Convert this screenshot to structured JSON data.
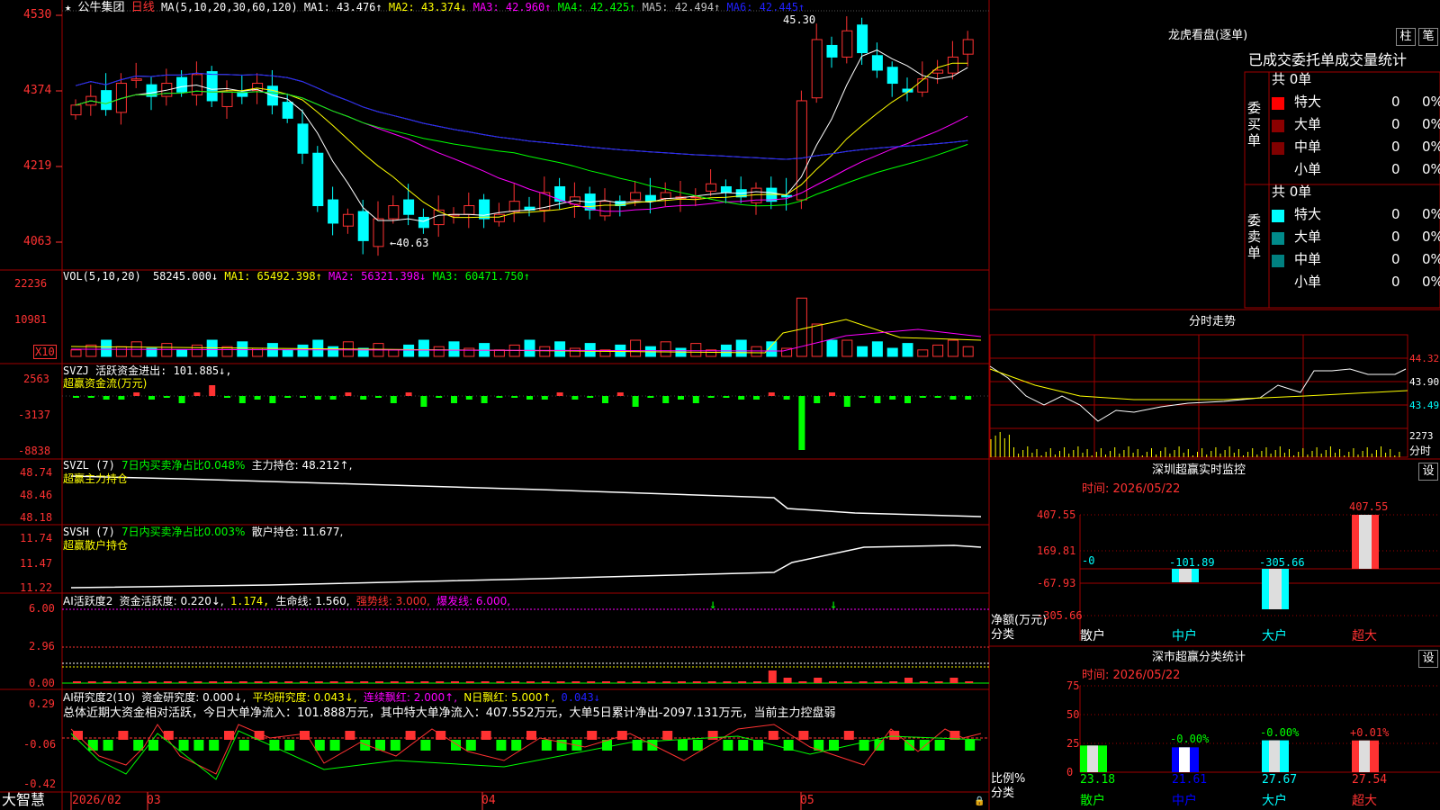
{
  "app": {
    "brand": "大智慧"
  },
  "colors": {
    "up": "#ff3232",
    "down": "#00ffff",
    "vol_green": "#00ff00",
    "grid": "#a00000",
    "label_red": "#ff3232"
  },
  "main": {
    "star": "★",
    "stock_name": "公牛集团",
    "period": "日线",
    "ma_spec": "MA(5,10,20,30,60,120)",
    "ma_items": [
      {
        "text": "MA1: 43.476↑",
        "color": "#ffffff"
      },
      {
        "text": "MA2: 43.374↓",
        "color": "#ffff00"
      },
      {
        "text": "MA3: 42.960↑",
        "color": "#ff00ff"
      },
      {
        "text": "MA4: 42.425↑",
        "color": "#00ff00"
      },
      {
        "text": "MA5: 42.494↑",
        "color": "#c0c0c0"
      },
      {
        "text": "MA6: 42.445↑",
        "color": "#2020ff"
      }
    ],
    "yticks": [
      "4530",
      "4374",
      "4219",
      "4063"
    ],
    "high_label": "45.30",
    "low_label": "←40.63"
  },
  "vol": {
    "spec": "VOL(5,10,20)",
    "value": "58245.000↓",
    "ma1": "MA1: 65492.398↑",
    "ma2": "MA2: 56321.398↓",
    "ma3": "MA3: 60471.750↑",
    "yticks": [
      "22236",
      "10981"
    ],
    "unit": "X10"
  },
  "svzj": {
    "header": "SVZJ  活跃资金进出: 101.885↓,",
    "sub": "超赢资金流(万元)",
    "yticks": [
      "2563",
      "-3137",
      "-8838"
    ]
  },
  "svzl": {
    "header_a": "SVZL (7)",
    "header_b": "7日内买卖净占比0.048%",
    "header_c": "主力持仓: 48.212↑,",
    "sub": "超赢主力持仓",
    "yticks": [
      "48.74",
      "48.46",
      "48.18"
    ]
  },
  "svsh": {
    "header_a": "SVSH (7)",
    "header_b": "7日内买卖净占比0.003%",
    "header_c": "散户持仓: 11.677,",
    "sub": "超赢散户持仓",
    "yticks": [
      "11.74",
      "11.47",
      "11.22"
    ]
  },
  "ai_active": {
    "h1": "AI活跃度2",
    "h2": "资金活跃度: 0.220↓,",
    "h3": "1.174,",
    "h4": "生命线: 1.560,",
    "h5": "强势线: 3.000,",
    "h6": "爆发线: 6.000,",
    "yticks": [
      "6.00",
      "2.96",
      "0.00"
    ]
  },
  "ai_research": {
    "h1": "AI研究度2(10)",
    "h2": "资金研究度: 0.000↓,",
    "h3": "平均研究度: 0.043↓,",
    "h4": "连续飘红: 2.000↑,",
    "h5": "N日飘红: 5.000↑,",
    "h6": "0.043↓",
    "comment": "总体近期大资金相对活跃，今日大单净流入：101.888万元，其中特大单净流入：407.552万元，大单5日累计净出-2097.131万元，当前主力控盘弱",
    "yticks": [
      "0.29",
      "-0.06",
      "-0.42"
    ]
  },
  "xaxis": {
    "labels": [
      "2026/02",
      "03",
      "04",
      "05"
    ]
  },
  "lhb": {
    "title": "龙虎看盘(逐单)",
    "btn1": "柱",
    "btn2": "笔",
    "subtitle": "已成交委托单成交量统计",
    "buy": {
      "side": "委买单",
      "count": "共 0单",
      "rows": [
        {
          "label": "特大",
          "vol": "0",
          "pct": "0%",
          "color": "#ff0000"
        },
        {
          "label": "大单",
          "vol": "0",
          "pct": "0%",
          "color": "#8b0000"
        },
        {
          "label": "中单",
          "vol": "0",
          "pct": "0%",
          "color": "#800000"
        },
        {
          "label": "小单",
          "vol": "0",
          "pct": "0%",
          "color": ""
        }
      ]
    },
    "sell": {
      "side": "委卖单",
      "count": "共 0单",
      "rows": [
        {
          "label": "特大",
          "vol": "0",
          "pct": "0%",
          "color": "#00ffff"
        },
        {
          "label": "大单",
          "vol": "0",
          "pct": "0%",
          "color": "#008b8b"
        },
        {
          "label": "中单",
          "vol": "0",
          "pct": "0%",
          "color": "#008080"
        },
        {
          "label": "小单",
          "vol": "0",
          "pct": "0%",
          "color": ""
        }
      ]
    }
  },
  "intraday": {
    "title": "分时走势",
    "y1": "44.32",
    "y2": "43.90",
    "y3": "43.49",
    "v1": "2273",
    "v2": "分时"
  },
  "monitor": {
    "title": "深圳超赢实时监控",
    "btn": "设",
    "time": "时间: 2026/05/22",
    "yticks": [
      "407.55",
      "169.81",
      "-67.93",
      "-305.66"
    ],
    "ylabel1": "净额(万元)",
    "ylabel2": "分类",
    "cats": [
      "散户",
      "中户",
      "大户",
      "超大"
    ],
    "values": [
      "-0",
      "-101.89",
      "-305.66",
      "407.55"
    ]
  },
  "classify": {
    "title": "深市超赢分类统计",
    "btn": "设",
    "time": "时间: 2026/05/22",
    "yticks": [
      "75",
      "50",
      "25",
      "0"
    ],
    "ylabel1": "比例%",
    "ylabel2": "分类",
    "cats": [
      "散户",
      "中户",
      "大户",
      "超大"
    ],
    "values": [
      "23.18",
      "21.61",
      "27.67",
      "27.54"
    ],
    "changes": [
      "",
      "-0.00%",
      "-0.00%",
      "+0.01%"
    ]
  }
}
